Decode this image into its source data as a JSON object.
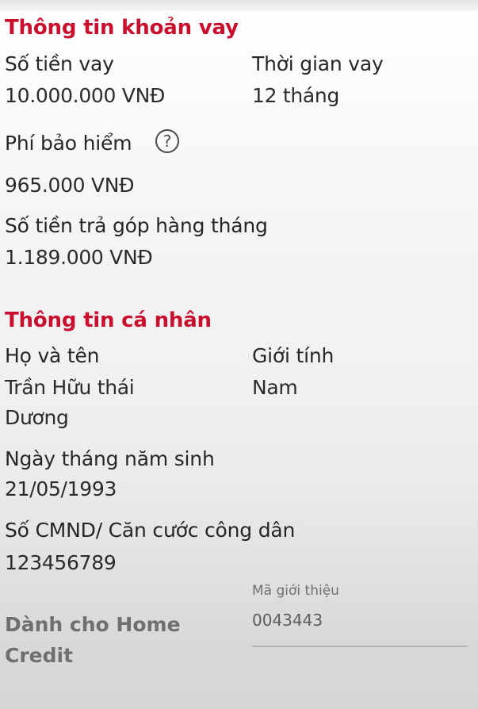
{
  "loan_info": {
    "section_title": "Thông tin khoản vay",
    "amount_label": "Số tiền vay",
    "amount_value": "10.000.000 VNĐ",
    "term_label": "Thời gian vay",
    "term_value": "12 tháng",
    "insurance_label": "Phí bảo hiểm",
    "insurance_help_icon": "question-circle-icon",
    "insurance_value": "965.000 VNĐ",
    "monthly_label": "Số tiền trả góp hàng tháng",
    "monthly_value": "1.189.000 VNĐ"
  },
  "personal_info": {
    "section_title": "Thông tin cá nhân",
    "name_label": "Họ và tên",
    "name_line1": "Trần Hữu thái",
    "name_line2": "Dương",
    "gender_label": "Giới tính",
    "gender_value": "Nam",
    "dob_label": "Ngày tháng năm sinh",
    "dob_value": "21/05/1993",
    "id_label": "Số CMND/ Căn cước công dân",
    "id_value": "123456789"
  },
  "home_credit": {
    "label_line1": "Dành cho Home",
    "label_line2": "Credit",
    "referral_label": "Mã giới thiệu",
    "referral_value": "0043443"
  },
  "colors": {
    "accent": "#c8102e",
    "text": "#222222",
    "muted": "#6f6f6f"
  }
}
